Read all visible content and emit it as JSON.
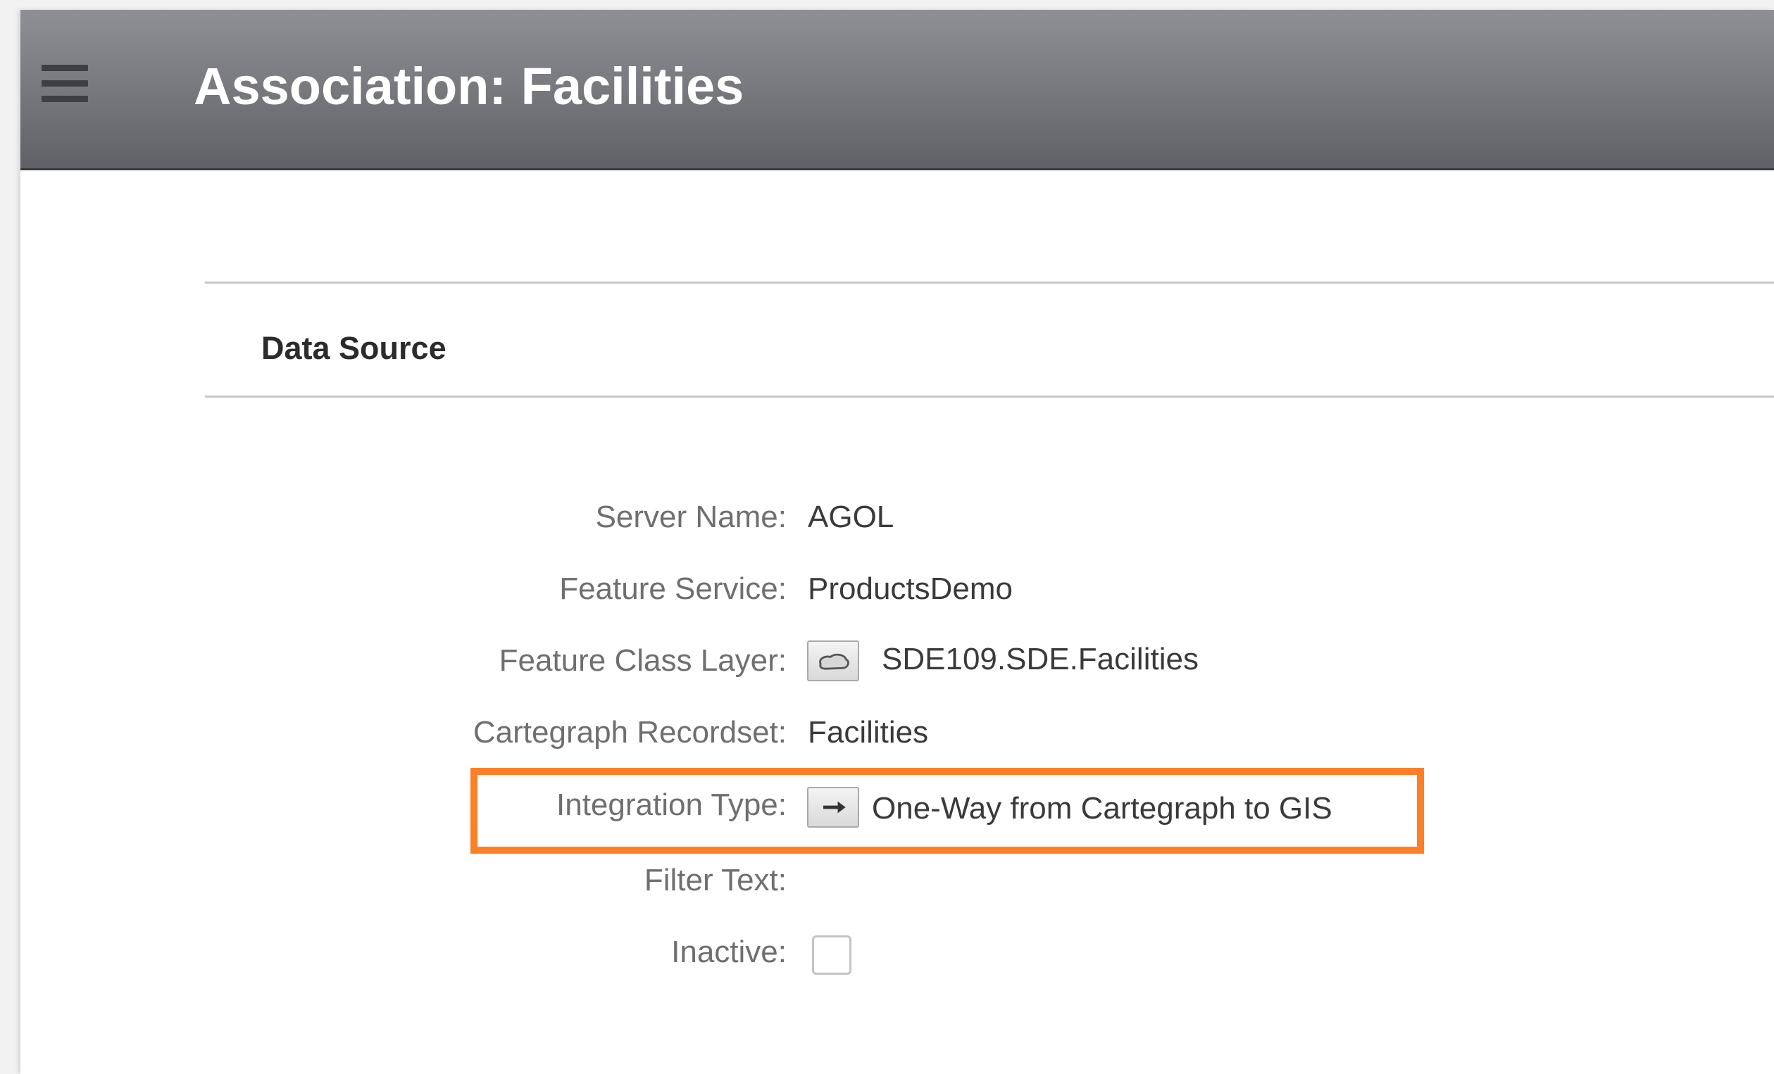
{
  "header": {
    "title": "Association: Facilities",
    "menu_icon": "hamburger-menu-icon"
  },
  "section": {
    "title": "Data Source"
  },
  "fields": {
    "server_name": {
      "label": "Server Name:",
      "value": "AGOL"
    },
    "feature_service": {
      "label": "Feature Service:",
      "value": "ProductsDemo"
    },
    "feature_class_layer": {
      "label": "Feature Class Layer:",
      "value": "SDE109.SDE.Facilities",
      "icon": "polygon-layer-icon"
    },
    "cartegraph_recordset": {
      "label": "Cartegraph Recordset:",
      "value": "Facilities"
    },
    "integration_type": {
      "label": "Integration Type:",
      "value": "One-Way from Cartegraph to GIS",
      "icon": "right-arrow-icon"
    },
    "filter_text": {
      "label": "Filter Text:",
      "value": ""
    },
    "inactive": {
      "label": "Inactive:",
      "checked": false
    }
  },
  "colors": {
    "highlight": "#ff7f27",
    "header_gradient_top": "#8f9095",
    "header_gradient_bottom": "#606166"
  }
}
